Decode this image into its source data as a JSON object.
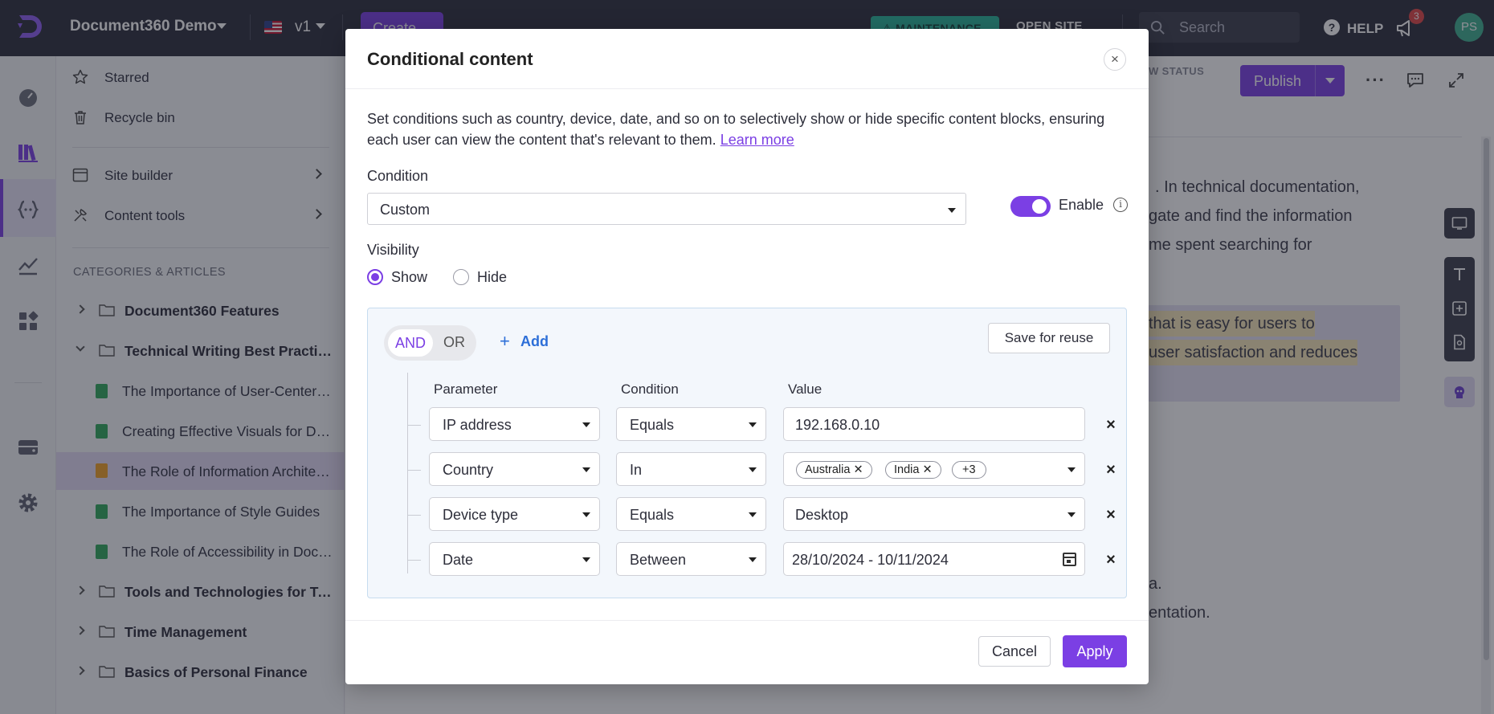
{
  "topbar": {
    "project_name": "Document360 Demo",
    "version": "v1",
    "create_label": "Create",
    "maintenance_label": "⚠ MAINTENANCE",
    "open_site_label": "OPEN SITE",
    "search_placeholder": "Search",
    "help_label": "HELP",
    "notification_count": "3",
    "avatar_initials": "PS",
    "accent_color": "#7b3fe4"
  },
  "sidebar": {
    "top_items": [
      {
        "label": "Starred",
        "icon": "star-icon"
      },
      {
        "label": "Recycle bin",
        "icon": "trash-icon"
      },
      {
        "label": "Site builder",
        "icon": "window-icon"
      },
      {
        "label": "Content tools",
        "icon": "tools-icon"
      }
    ],
    "section_title": "CATEGORIES & ARTICLES",
    "tree": [
      {
        "label": "Document360 Features",
        "kind": "folder",
        "expanded": false
      },
      {
        "label": "Technical Writing Best Practices",
        "kind": "folder",
        "expanded": true
      },
      {
        "label": "The Importance of User-Centered Design",
        "kind": "article",
        "status": "published"
      },
      {
        "label": "Creating Effective Visuals for Documentation",
        "kind": "article",
        "status": "published"
      },
      {
        "label": "The Role of Information Architecture",
        "kind": "article",
        "status": "draft",
        "active": true
      },
      {
        "label": "The Importance of Style Guides",
        "kind": "article",
        "status": "published"
      },
      {
        "label": "The Role of Accessibility in Documentation",
        "kind": "article",
        "status": "published"
      },
      {
        "label": "Tools and Technologies for Technical Writing",
        "kind": "folder",
        "expanded": false
      },
      {
        "label": "Time Management",
        "kind": "folder",
        "expanded": false
      },
      {
        "label": "Basics of Personal Finance",
        "kind": "folder",
        "expanded": false
      }
    ]
  },
  "editor": {
    "view_status_label": "W STATUS",
    "publish_label": "Publish",
    "bg_lines": [
      ". In technical documentation,",
      "gate and find the information",
      "me spent searching for",
      "that is easy for users to",
      "user satisfaction and reduces",
      "a.",
      "entation."
    ]
  },
  "modal": {
    "title": "Conditional content",
    "description": "Set conditions such as country, device, date, and so on to selectively show or hide specific content blocks, ensuring each user can view the content that's relevant to them.",
    "learn_more": "Learn more",
    "condition_label": "Condition",
    "condition_value": "Custom",
    "enable_label": "Enable",
    "enable_on": true,
    "visibility_label": "Visibility",
    "visibility_options": [
      "Show",
      "Hide"
    ],
    "visibility_selected": "Show",
    "logic": {
      "and_label": "AND",
      "or_label": "OR",
      "selected": "AND"
    },
    "add_label": "Add",
    "save_reuse_label": "Save for reuse",
    "columns": [
      "Parameter",
      "Condition",
      "Value"
    ],
    "rules": [
      {
        "parameter": "IP address",
        "condition": "Equals",
        "value": "192.168.0.10"
      },
      {
        "parameter": "Country",
        "condition": "In",
        "chips": [
          "Australia",
          "India",
          "+3"
        ]
      },
      {
        "parameter": "Device type",
        "condition": "Equals",
        "value": "Desktop"
      },
      {
        "parameter": "Date",
        "condition": "Between",
        "value": "28/10/2024 - 10/11/2024"
      }
    ],
    "cancel_label": "Cancel",
    "apply_label": "Apply"
  }
}
